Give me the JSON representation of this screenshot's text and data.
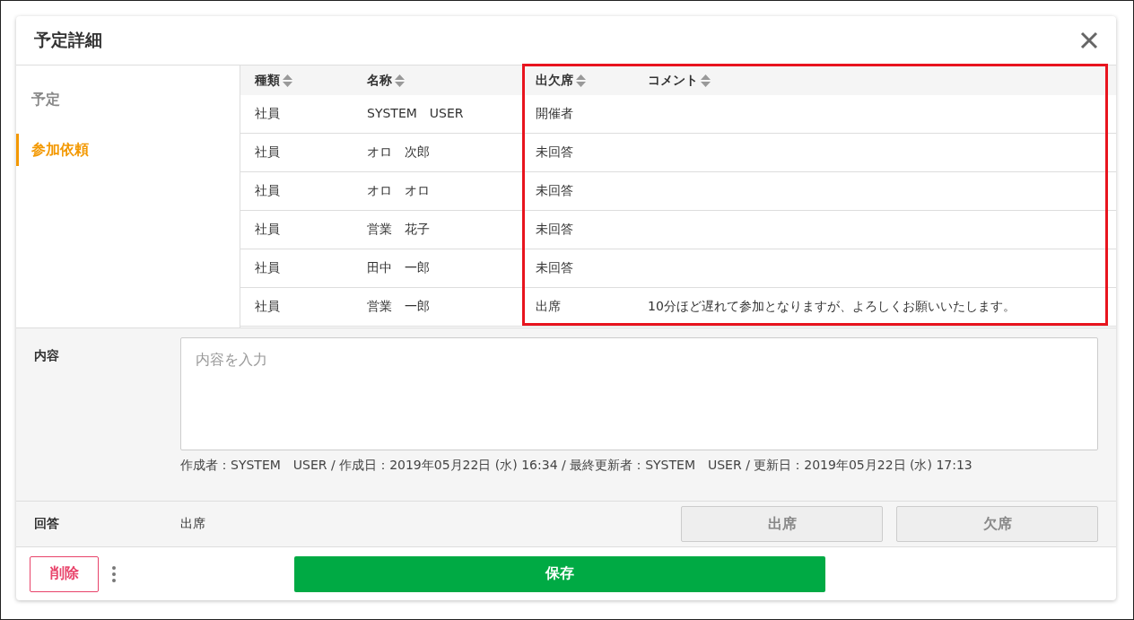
{
  "dialog": {
    "title": "予定詳細"
  },
  "sidebar": {
    "items": [
      {
        "label": "予定",
        "selected": false
      },
      {
        "label": "参加依頼",
        "selected": true
      }
    ]
  },
  "table": {
    "columns": [
      "種類",
      "名称",
      "出欠席",
      "コメント"
    ],
    "rows": [
      [
        "社員",
        "SYSTEM　USER",
        "開催者",
        ""
      ],
      [
        "社員",
        "オロ　次郎",
        "未回答",
        ""
      ],
      [
        "社員",
        "オロ　オロ",
        "未回答",
        ""
      ],
      [
        "社員",
        "営業　花子",
        "未回答",
        ""
      ],
      [
        "社員",
        "田中　一郎",
        "未回答",
        ""
      ],
      [
        "社員",
        "営業　一郎",
        "出席",
        "10分ほど遅れて参加となりますが、よろしくお願いいたします。"
      ]
    ]
  },
  "content": {
    "label": "内容",
    "placeholder": "内容を入力",
    "meta": "作成者：SYSTEM　USER / 作成日：2019年05月22日 (水) 16:34 / 最終更新者：SYSTEM　USER / 更新日：2019年05月22日 (水) 17:13"
  },
  "answer": {
    "label": "回答",
    "value": "出席",
    "buttons": [
      {
        "label": "出席",
        "disabled": true
      },
      {
        "label": "欠席",
        "disabled": true
      }
    ]
  },
  "footer": {
    "delete": "削除",
    "save": "保存"
  }
}
